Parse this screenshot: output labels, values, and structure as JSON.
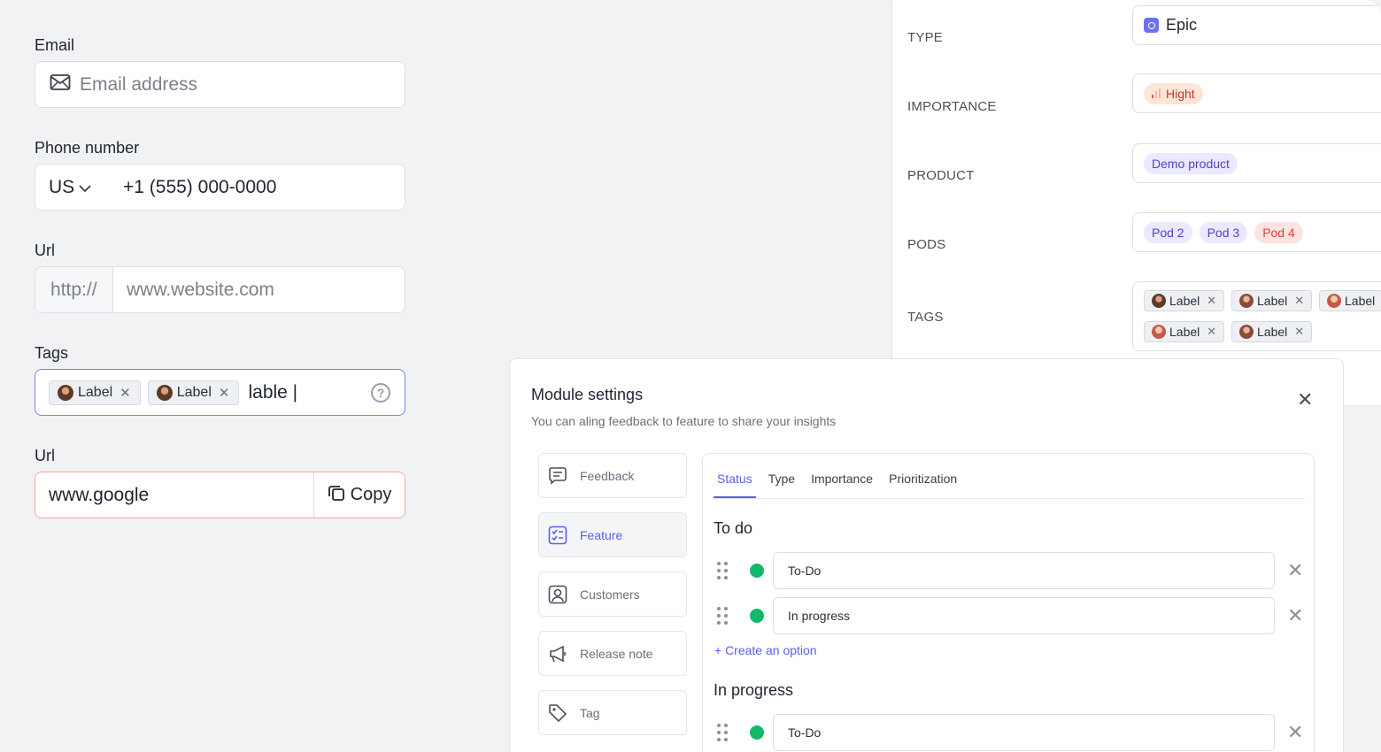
{
  "form": {
    "email": {
      "label": "Email",
      "placeholder": "Email address"
    },
    "phone": {
      "label": "Phone number",
      "country": "US",
      "value": "+1 (555) 000-0000"
    },
    "url": {
      "label": "Url",
      "prefix": "http://",
      "placeholder": "www.website.com"
    },
    "tags": {
      "label": "Tags",
      "chips": [
        "Label",
        "Label"
      ],
      "typed": "lable |"
    },
    "url_copy": {
      "label": "Url",
      "value": "www.google",
      "button": "Copy"
    }
  },
  "properties": {
    "type": {
      "label": "TYPE",
      "value": "Epic"
    },
    "importance": {
      "label": "IMPORTANCE",
      "value": "Hight"
    },
    "product": {
      "label": "PRODUCT",
      "value": "Demo product"
    },
    "pods": {
      "label": "PODS",
      "values": [
        "Pod 2",
        "Pod 3",
        "Pod 4"
      ]
    },
    "tags": {
      "label": "TAGS",
      "chips": [
        "Label",
        "Label",
        "Label",
        "Label",
        "Label"
      ]
    }
  },
  "dialog": {
    "title": "Module settings",
    "subtitle": "You can aling feedback to feature to share your insights",
    "sidebar": [
      {
        "label": "Feedback",
        "icon": "message-icon"
      },
      {
        "label": "Feature",
        "icon": "checklist-icon"
      },
      {
        "label": "Customers",
        "icon": "user-square-icon"
      },
      {
        "label": "Release note",
        "icon": "megaphone-icon"
      },
      {
        "label": "Tag",
        "icon": "tag-icon"
      }
    ],
    "tabs": [
      "Status",
      "Type",
      "Importance",
      "Prioritization"
    ],
    "sections": [
      {
        "title": "To do",
        "options": [
          "To-Do",
          "In progress"
        ]
      },
      {
        "title": "In progress",
        "options": [
          "To-Do"
        ]
      }
    ],
    "create_option": "+ Create an option"
  },
  "colors": {
    "accent": "#5a60e8",
    "status_green": "#12b76a",
    "error_border": "#f2a79a"
  }
}
